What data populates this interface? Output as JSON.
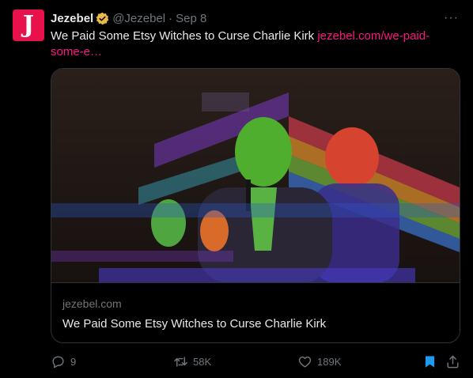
{
  "author": {
    "avatar_letter": "J",
    "name": "Jezebel",
    "handle": "@Jezebel",
    "separator": "·",
    "date": "Sep 8",
    "brand_color": "#e8114b",
    "verified_color": "#e8b84a"
  },
  "more_label": "···",
  "tweet": {
    "text": "We Paid Some Etsy Witches to Curse Charlie Kirk ",
    "link": "jezebel.com/we-paid-some-e…",
    "link_color": "#f91880"
  },
  "card": {
    "domain": "jezebel.com",
    "title": "We Paid Some Etsy Witches to Curse Charlie Kirk",
    "image_icon": "glitched-photo"
  },
  "actions": {
    "replies": "9",
    "reposts": "58K",
    "likes": "189K",
    "bookmark_icon": "bookmark-filled-icon",
    "share_icon": "share-icon",
    "bookmark_color": "#1d9bf0"
  }
}
